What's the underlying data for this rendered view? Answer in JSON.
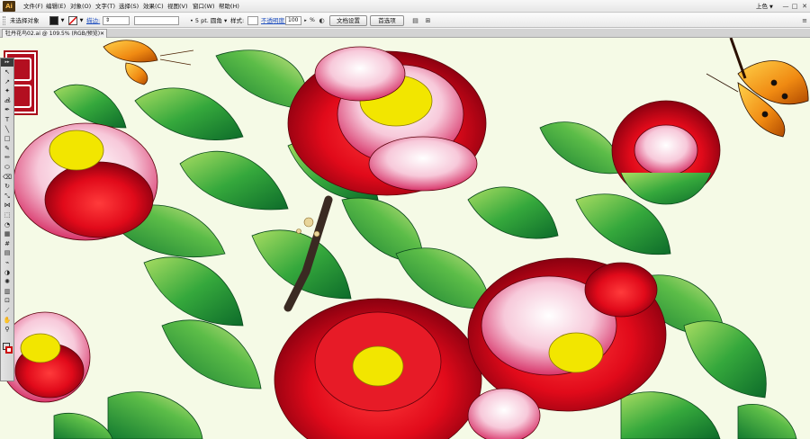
{
  "app": {
    "logo_text": "Ai",
    "workspace_label": "上色",
    "window_buttons": [
      "—",
      "□",
      "✕"
    ]
  },
  "menu": {
    "items": [
      {
        "label": "文件(F)"
      },
      {
        "label": "编辑(E)"
      },
      {
        "label": "对象(O)"
      },
      {
        "label": "文字(T)"
      },
      {
        "label": "选择(S)"
      },
      {
        "label": "效果(C)"
      },
      {
        "label": "视图(V)"
      },
      {
        "label": "窗口(W)"
      },
      {
        "label": "帮助(H)"
      }
    ]
  },
  "control_bar": {
    "selection_status": "未选择对象",
    "stroke_label": "描边:",
    "brush_value": "5 pt. 圆角",
    "style_label": "样式:",
    "opacity_label": "不透明度:",
    "opacity_value": "100",
    "opacity_unit": "%",
    "doc_setup_button": "文档设置",
    "preferences_button": "首选项",
    "colors": {
      "fill": "#1a1a1a",
      "stroke": "#ffffff"
    }
  },
  "document": {
    "tab_title": "牡丹花鸟02.ai @ 109.5% (RGB/预览)",
    "close_glyph": "✕"
  },
  "toolbox": {
    "header_glyph": "▸▸",
    "tools": [
      {
        "icon": "selection-tool-icon",
        "glyph": "↖"
      },
      {
        "icon": "direct-selection-tool-icon",
        "glyph": "↗"
      },
      {
        "icon": "magic-wand-tool-icon",
        "glyph": "✦"
      },
      {
        "icon": "lasso-tool-icon",
        "glyph": "ൿ"
      },
      {
        "icon": "pen-tool-icon",
        "glyph": "✒"
      },
      {
        "icon": "type-tool-icon",
        "glyph": "T"
      },
      {
        "icon": "line-tool-icon",
        "glyph": "╲"
      },
      {
        "icon": "rectangle-tool-icon",
        "glyph": "□"
      },
      {
        "icon": "paintbrush-tool-icon",
        "glyph": "✎"
      },
      {
        "icon": "pencil-tool-icon",
        "glyph": "✏"
      },
      {
        "icon": "blob-brush-tool-icon",
        "glyph": "⬭"
      },
      {
        "icon": "eraser-tool-icon",
        "glyph": "⌫"
      },
      {
        "icon": "rotate-tool-icon",
        "glyph": "↻"
      },
      {
        "icon": "scale-tool-icon",
        "glyph": "⤡"
      },
      {
        "icon": "width-tool-icon",
        "glyph": "⋈"
      },
      {
        "icon": "free-transform-tool-icon",
        "glyph": "⬚"
      },
      {
        "icon": "shape-builder-tool-icon",
        "glyph": "◔"
      },
      {
        "icon": "perspective-grid-tool-icon",
        "glyph": "▦"
      },
      {
        "icon": "mesh-tool-icon",
        "glyph": "#"
      },
      {
        "icon": "gradient-tool-icon",
        "glyph": "▤"
      },
      {
        "icon": "eyedropper-tool-icon",
        "glyph": "⌁"
      },
      {
        "icon": "blend-tool-icon",
        "glyph": "◑"
      },
      {
        "icon": "symbol-sprayer-tool-icon",
        "glyph": "✺"
      },
      {
        "icon": "column-graph-tool-icon",
        "glyph": "▥"
      },
      {
        "icon": "artboard-tool-icon",
        "glyph": "⊡"
      },
      {
        "icon": "slice-tool-icon",
        "glyph": "⟋"
      },
      {
        "icon": "hand-tool-icon",
        "glyph": "✋"
      },
      {
        "icon": "zoom-tool-icon",
        "glyph": "⚲"
      }
    ],
    "fill_color": "#d8d8d8",
    "stroke_color": "#cc0000"
  },
  "canvas": {
    "background": "#f5fae6",
    "palette": {
      "peony_red": "#e10a1a",
      "peony_dark": "#8a0010",
      "peony_pink": "#f5b7cf",
      "leaf_green": "#2fa33a",
      "leaf_light": "#8fd35a",
      "leaf_dark": "#0d6b2a",
      "stamen": "#f2e600",
      "butterfly_orange": "#f08a12"
    }
  }
}
